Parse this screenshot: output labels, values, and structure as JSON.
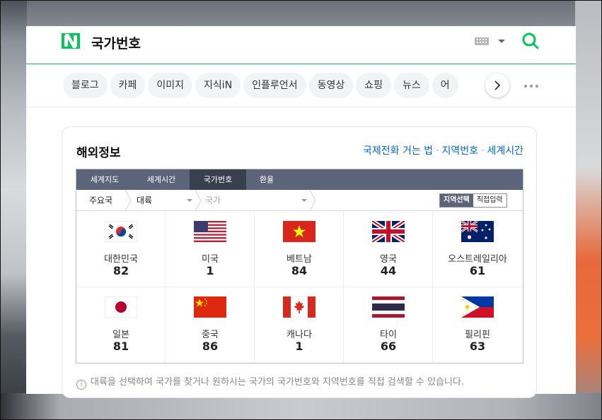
{
  "header": {
    "query": "국가번호"
  },
  "tabs": [
    {
      "label": "블로그"
    },
    {
      "label": "카페"
    },
    {
      "label": "이미지"
    },
    {
      "label": "지식iN"
    },
    {
      "label": "인플루언서"
    },
    {
      "label": "동영상"
    },
    {
      "label": "쇼핑"
    },
    {
      "label": "뉴스"
    },
    {
      "label": "어"
    }
  ],
  "card": {
    "title": "해외정보",
    "links": [
      "국제전화 거는 법",
      "지역번호",
      "세계시간"
    ],
    "widget_tabs": [
      {
        "label": "세계지도"
      },
      {
        "label": "세계시간"
      },
      {
        "label": "국가번호",
        "active": true
      },
      {
        "label": "환율"
      }
    ],
    "filter": {
      "region_label": "주요국",
      "continent_select": "대륙",
      "country_select": "국가",
      "mode_selected": "지역선택",
      "mode_other": "직접입력"
    },
    "countries": [
      {
        "name": "대한민국",
        "code": "82",
        "flag": "korea"
      },
      {
        "name": "미국",
        "code": "1",
        "flag": "usa"
      },
      {
        "name": "베트남",
        "code": "84",
        "flag": "vietnam"
      },
      {
        "name": "영국",
        "code": "44",
        "flag": "uk"
      },
      {
        "name": "오스트레일리아",
        "code": "61",
        "flag": "australia"
      },
      {
        "name": "일본",
        "code": "81",
        "flag": "japan"
      },
      {
        "name": "중국",
        "code": "86",
        "flag": "china"
      },
      {
        "name": "캐나다",
        "code": "1",
        "flag": "canada"
      },
      {
        "name": "타이",
        "code": "66",
        "flag": "thailand"
      },
      {
        "name": "필리핀",
        "code": "63",
        "flag": "philippines"
      }
    ],
    "footnote": "대륙을 선택하여 국가를 찾거나 원하시는 국가의 국가번호와 지역번호를 직접 검색할 수 있습니다."
  },
  "colors": {
    "brand_green": "#03c75a",
    "link_blue": "#0068c3",
    "widget_tab_bg": "#5b6478",
    "widget_tab_active": "#39404d"
  }
}
